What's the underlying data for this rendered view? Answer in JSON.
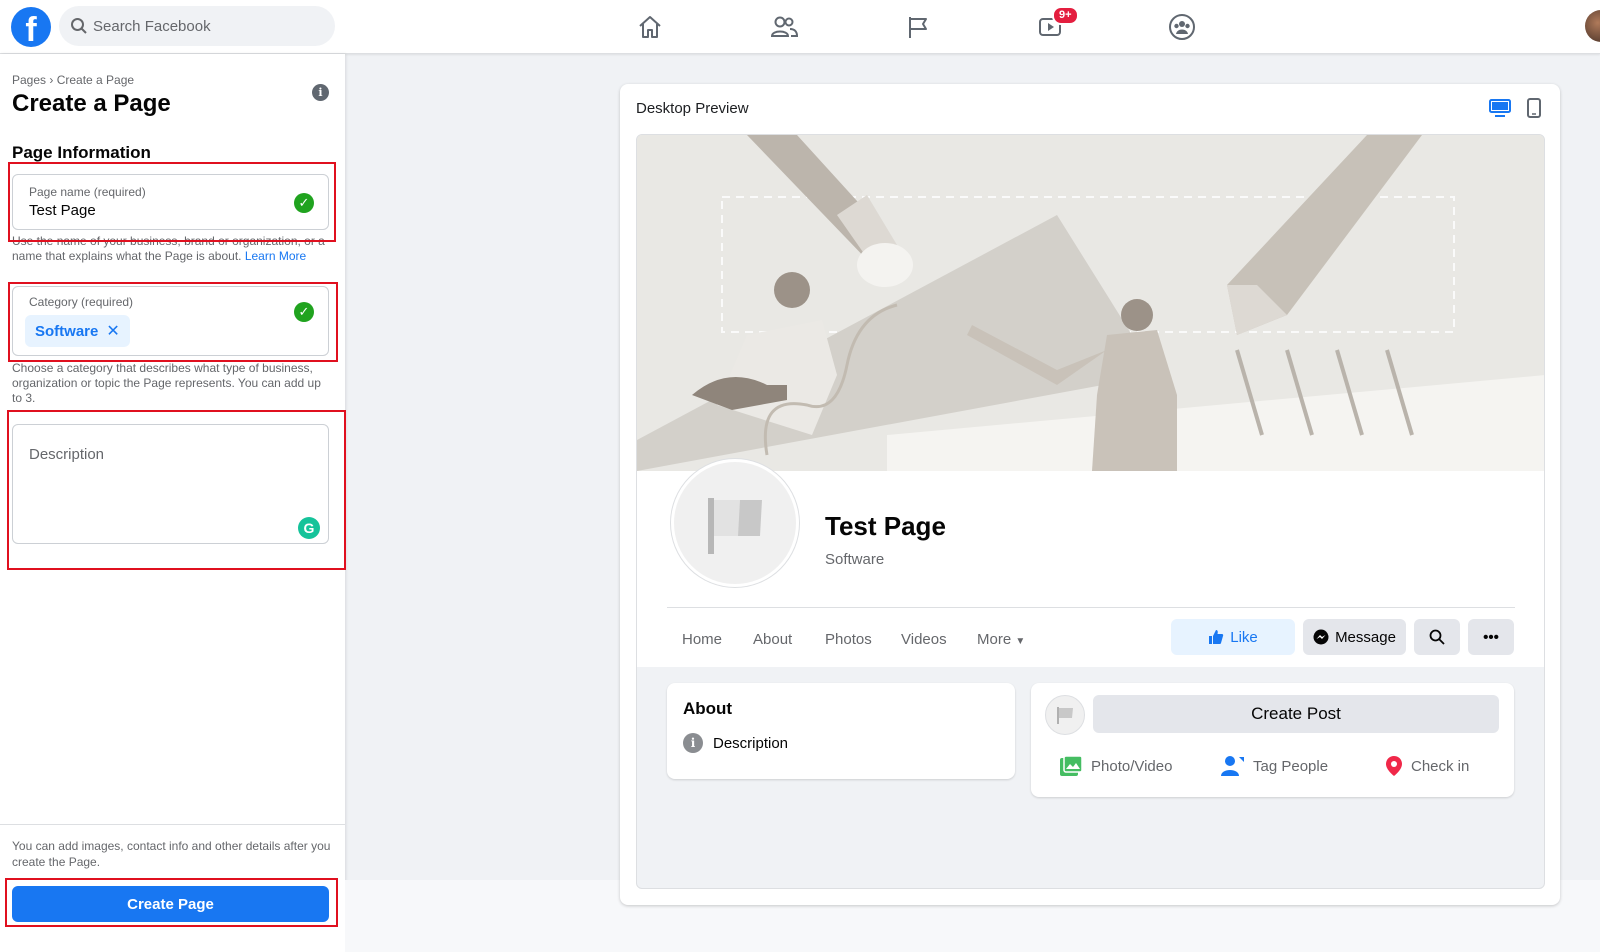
{
  "topbar": {
    "logo": "f",
    "search_placeholder": "Search Facebook",
    "video_badge": "9+",
    "nav_icons": [
      "home-icon",
      "friends-icon",
      "pages-flag-icon",
      "watch-icon",
      "groups-icon"
    ]
  },
  "left": {
    "breadcrumb": "Pages › Create a Page",
    "title": "Create a Page",
    "section": "Page Information",
    "page_name_label": "Page name (required)",
    "page_name_value": "Test Page",
    "page_name_help": "Use the name of your business, brand or organization, or a name that explains what the Page is about.",
    "learn_more": "Learn More",
    "category_label": "Category (required)",
    "category_chip": "Software",
    "category_help": "Choose a category that describes what type of business, organization or topic the Page represents. You can add up to 3.",
    "description_placeholder": "Description",
    "footer_note": "You can add images, contact info and other details after you create the Page.",
    "create_button": "Create Page"
  },
  "preview": {
    "title": "Desktop Preview",
    "page_name": "Test Page",
    "page_category": "Software",
    "tabs": [
      "Home",
      "About",
      "Photos",
      "Videos",
      "More"
    ],
    "like": "Like",
    "message": "Message",
    "about_title": "About",
    "about_description": "Description",
    "create_post": "Create Post",
    "photo_video": "Photo/Video",
    "tag_people": "Tag People",
    "check_in": "Check in"
  },
  "colors": {
    "brand": "#1877f2",
    "success": "#20a31f",
    "highlight": "#e0101f"
  }
}
